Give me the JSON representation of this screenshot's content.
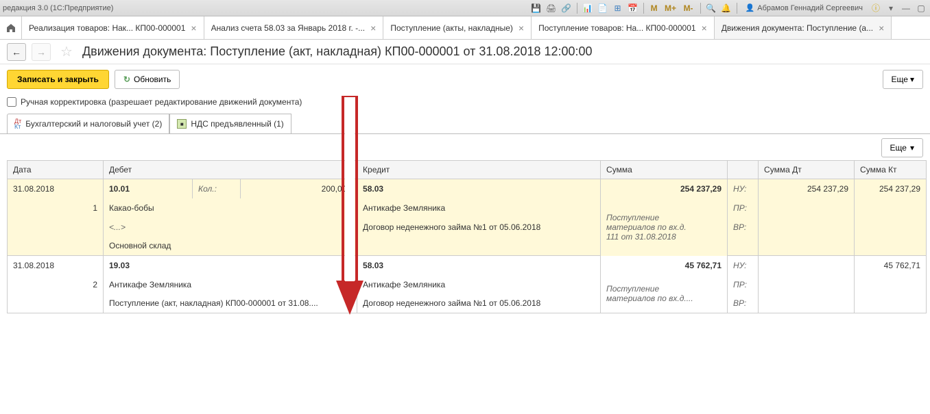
{
  "titlebar": {
    "text": "редакция 3.0  (1С:Предприятие)",
    "user": "Абрамов Геннадий Сергеевич",
    "m_labels": [
      "M",
      "M+",
      "M-"
    ]
  },
  "tabs": [
    {
      "label": "Реализация товаров: Нак... КП00-000001"
    },
    {
      "label": "Анализ счета 58.03 за Январь 2018 г. -..."
    },
    {
      "label": "Поступление (акты, накладные)"
    },
    {
      "label": "Поступление товаров: На... КП00-000001"
    },
    {
      "label": "Движения документа: Поступление (а...",
      "active": true
    }
  ],
  "page_title": "Движения документа: Поступление (акт, накладная) КП00-000001 от 31.08.2018 12:00:00",
  "toolbar": {
    "write_close": "Записать и закрыть",
    "refresh": "Обновить",
    "more": "Еще"
  },
  "checkbox_label": "Ручная корректировка (разрешает редактирование движений документа)",
  "inner_tabs": {
    "accounting": "Бухгалтерский и налоговый учет (2)",
    "vat": "НДС предъявленный (1)"
  },
  "grid": {
    "headers": {
      "date": "Дата",
      "debit": "Дебет",
      "credit": "Кредит",
      "sum": "Сумма",
      "sum_dt": "Сумма Дт",
      "sum_kt": "Сумма Кт"
    },
    "labels": {
      "qty": "Кол.:",
      "nu": "НУ:",
      "pr": "ПР:",
      "vr": "ВР:",
      "placeholder": "<...>"
    },
    "rows": [
      {
        "date": "31.08.2018",
        "num": "1",
        "debit_acc": "10.01",
        "qty": "200,000",
        "debit_line1": "Какао-бобы",
        "debit_line3": "Основной склад",
        "credit_acc": "58.03",
        "credit_line1": "Антикафе Земляника",
        "credit_line2": "Договор неденежного займа №1 от 05.06.2018",
        "sum": "254 237,29",
        "sum_note1": "Поступление",
        "sum_note2": "материалов по вх.д.",
        "sum_note3": "111 от 31.08.2018",
        "sum_dt": "254 237,29",
        "sum_kt": "254 237,29"
      },
      {
        "date": "31.08.2018",
        "num": "2",
        "debit_acc": "19.03",
        "debit_line1": "Антикафе Земляника",
        "debit_line2": "Поступление (акт, накладная) КП00-000001 от 31.08....",
        "credit_acc": "58.03",
        "credit_line1": "Антикафе Земляника",
        "credit_line2": "Договор неденежного займа №1 от 05.06.2018",
        "sum": "45 762,71",
        "sum_note1": "Поступление",
        "sum_note2": "материалов по вх.д....",
        "sum_kt": "45 762,71"
      }
    ]
  }
}
